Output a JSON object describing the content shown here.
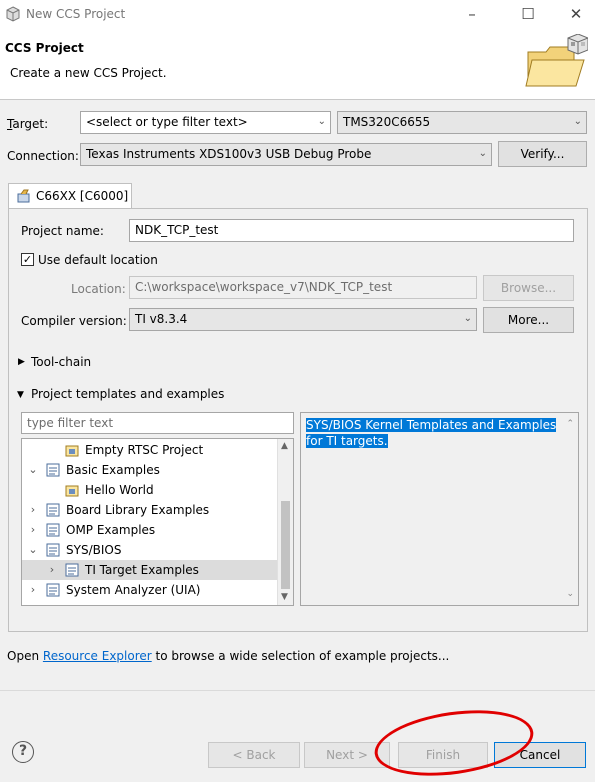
{
  "window": {
    "title": "New CCS Project",
    "controls": [
      "minimize-icon",
      "maximize-icon",
      "close-icon"
    ]
  },
  "banner": {
    "heading": "CCS Project",
    "description": "Create a new CCS Project."
  },
  "target": {
    "label": "Target:",
    "filter_value": "<select or type filter text>",
    "device_value": "TMS320C6655"
  },
  "connection": {
    "label": "Connection:",
    "value": "Texas Instruments XDS100v3 USB Debug Probe",
    "verify_button": "Verify..."
  },
  "tab": {
    "label": "C66XX [C6000]"
  },
  "project": {
    "name_label": "Project name:",
    "name_value": "NDK_TCP_test",
    "use_default_label": "Use default location",
    "use_default_checked": true,
    "location_label": "Location:",
    "location_value": "C:\\workspace\\workspace_v7\\NDK_TCP_test",
    "browse_button": "Browse...",
    "compiler_label": "Compiler version:",
    "compiler_value": "TI v8.3.4",
    "more_button": "More..."
  },
  "sections": {
    "toolchain": "Tool-chain",
    "templates": "Project templates and examples"
  },
  "templates": {
    "filter_placeholder": "type filter text",
    "tree": [
      {
        "label": "Empty RTSC Project",
        "chevron": "",
        "icon": "project-icon",
        "selected": false
      },
      {
        "label": "Basic Examples",
        "chevron": "expanded",
        "icon": "template-category-icon",
        "selected": false
      },
      {
        "label": "Hello World",
        "chevron": "",
        "icon": "project-icon",
        "selected": false
      },
      {
        "label": "Board Library Examples",
        "chevron": "collapsed",
        "icon": "template-category-icon",
        "selected": false
      },
      {
        "label": "OMP Examples",
        "chevron": "collapsed",
        "icon": "template-category-icon",
        "selected": false
      },
      {
        "label": "SYS/BIOS",
        "chevron": "expanded",
        "icon": "template-category-icon",
        "selected": false
      },
      {
        "label": "TI Target Examples",
        "chevron": "collapsed",
        "icon": "template-category-icon",
        "selected": true
      },
      {
        "label": "System Analyzer (UIA)",
        "chevron": "collapsed",
        "icon": "template-category-icon",
        "selected": false
      }
    ],
    "description": "SYS/BIOS Kernel Templates and Examples for TI targets."
  },
  "footer": {
    "open_text": "Open",
    "link_text": "Resource Explorer",
    "rest_text": "to browse a wide selection of example projects..."
  },
  "buttons": {
    "back": "< Back",
    "next": "Next >",
    "finish": "Finish",
    "cancel": "Cancel"
  },
  "colors": {
    "selection": "#0078d7",
    "link": "#0066cc",
    "annotation": "#e00000"
  }
}
